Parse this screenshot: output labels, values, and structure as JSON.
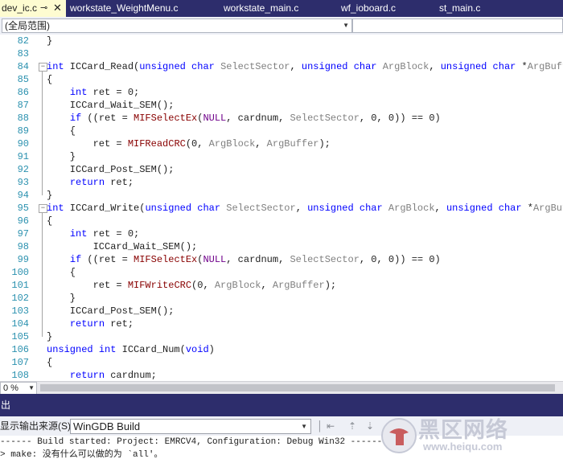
{
  "tabs": [
    {
      "label": "dev_ic.c",
      "active": true
    },
    {
      "label": "workstate_WeightMenu.c",
      "active": false
    },
    {
      "label": "workstate_main.c",
      "active": false
    },
    {
      "label": "wf_ioboard.c",
      "active": false
    },
    {
      "label": "st_main.c",
      "active": false
    }
  ],
  "tab_icons": {
    "pin": "pin-icon",
    "close": "close-icon"
  },
  "scope": {
    "selected": "(全局范围)"
  },
  "editor": {
    "zoom": "0 %",
    "lines": [
      {
        "n": "82",
        "text": "}"
      },
      {
        "n": "83",
        "text": ""
      },
      {
        "n": "84",
        "text": "int ICCard_Read(unsigned char SelectSector, unsigned char ArgBlock, unsigned char *ArgBuffer)"
      },
      {
        "n": "85",
        "text": "{"
      },
      {
        "n": "86",
        "text": "    int ret = 0;"
      },
      {
        "n": "87",
        "text": "    ICCard_Wait_SEM();"
      },
      {
        "n": "88",
        "text": "    if ((ret = MIFSelectEx(NULL, cardnum, SelectSector, 0, 0)) == 0)"
      },
      {
        "n": "89",
        "text": "    {"
      },
      {
        "n": "90",
        "text": "        ret = MIFReadCRC(0, ArgBlock, ArgBuffer);"
      },
      {
        "n": "91",
        "text": "    }"
      },
      {
        "n": "92",
        "text": "    ICCard_Post_SEM();"
      },
      {
        "n": "93",
        "text": "    return ret;"
      },
      {
        "n": "94",
        "text": "}"
      },
      {
        "n": "95",
        "text": "int ICCard_Write(unsigned char SelectSector, unsigned char ArgBlock, unsigned char *ArgBuffer)"
      },
      {
        "n": "96",
        "text": "{"
      },
      {
        "n": "97",
        "text": "    int ret = 0;"
      },
      {
        "n": "98",
        "text": "        ICCard_Wait_SEM();"
      },
      {
        "n": "99",
        "text": "    if ((ret = MIFSelectEx(NULL, cardnum, SelectSector, 0, 0)) == 0)"
      },
      {
        "n": "100",
        "text": "    {"
      },
      {
        "n": "101",
        "text": "        ret = MIFWriteCRC(0, ArgBlock, ArgBuffer);"
      },
      {
        "n": "102",
        "text": "    }"
      },
      {
        "n": "103",
        "text": "    ICCard_Post_SEM();"
      },
      {
        "n": "104",
        "text": "    return ret;"
      },
      {
        "n": "105",
        "text": "}"
      },
      {
        "n": "106",
        "text": "unsigned int ICCard_Num(void)"
      },
      {
        "n": "107",
        "text": "{"
      },
      {
        "n": "108",
        "text": "    return cardnum;"
      }
    ]
  },
  "output": {
    "title": "出",
    "source_label": "显示输出来源(S):",
    "source_value": "WinGDB Build",
    "lines": [
      "------ Build started: Project: EMRCV4, Configuration: Debug Win32 ------",
      "> make: 没有什么可以做的为 `all'。"
    ]
  },
  "watermark": {
    "text": "黑区网络",
    "url": "www.heiqu.com"
  },
  "colors": {
    "tab_bar": "#2d2d6c",
    "active_tab": "#fefcd1",
    "keyword": "#0000ff",
    "parameter": "#808080",
    "function": "#880000",
    "macro": "#6f008a",
    "line_number": "#2b91af"
  }
}
